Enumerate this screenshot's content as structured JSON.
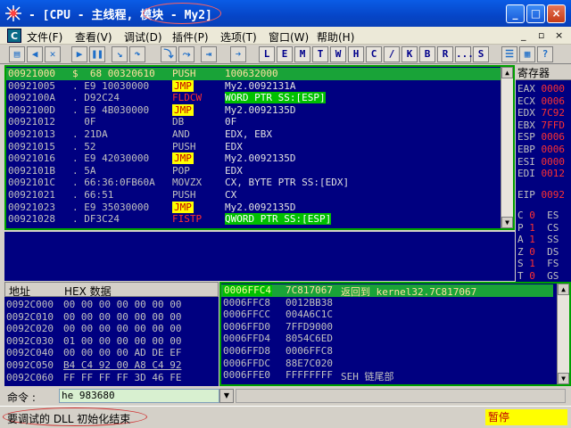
{
  "window": {
    "title": "- [CPU - 主线程, 模块 - My2]",
    "min": "_",
    "max": "□",
    "close": "×"
  },
  "menu": {
    "cpu_icon": "C",
    "items": [
      "文件(F)",
      "查看(V)",
      "调试(D)",
      "插件(P)",
      "选项(T)",
      "窗口(W)",
      "帮助(H)"
    ],
    "mdi": [
      "_",
      "▫",
      "×"
    ]
  },
  "toolbar": {
    "letters": [
      "L",
      "E",
      "M",
      "T",
      "W",
      "H",
      "C",
      "/",
      "K",
      "B",
      "R",
      "...",
      "S"
    ]
  },
  "disasm": {
    "rows": [
      {
        "addr": "00921000",
        "hex": "$  68 00320610",
        "mnem": "PUSH",
        "ops": "100632000",
        "sel": true
      },
      {
        "addr": "00921005",
        "hex": ". E9 10030000",
        "mnem": "JMP",
        "ops": "My2.0092131A",
        "tag": "jmp"
      },
      {
        "addr": "0092100A",
        "hex": ". D92C24",
        "mnem": "FLDCW",
        "ops": "WORD PTR SS:[ESP]",
        "tag": "red",
        "hl": true
      },
      {
        "addr": "0092100D",
        "hex": ". E9 4B030000",
        "mnem": "JMP",
        "ops": "My2.0092135D",
        "tag": "jmp"
      },
      {
        "addr": "00921012",
        "hex": "  0F",
        "mnem": "DB",
        "ops": "0F"
      },
      {
        "addr": "00921013",
        "hex": ". 21DA",
        "mnem": "AND",
        "ops": "EDX, EBX"
      },
      {
        "addr": "00921015",
        "hex": ". 52",
        "mnem": "PUSH",
        "ops": "EDX"
      },
      {
        "addr": "00921016",
        "hex": ". E9 42030000",
        "mnem": "JMP",
        "ops": "My2.0092135D",
        "tag": "jmp"
      },
      {
        "addr": "0092101B",
        "hex": ". 5A",
        "mnem": "POP",
        "ops": "EDX"
      },
      {
        "addr": "0092101C",
        "hex": ". 66:36:0FB60A",
        "mnem": "MOVZX",
        "ops": "CX, BYTE PTR SS:[EDX]"
      },
      {
        "addr": "00921021",
        "hex": ". 66:51",
        "mnem": "PUSH",
        "ops": "CX"
      },
      {
        "addr": "00921023",
        "hex": ". E9 35030000",
        "mnem": "JMP",
        "ops": "My2.0092135D",
        "tag": "jmp"
      },
      {
        "addr": "00921028",
        "hex": ". DF3C24",
        "mnem": "FISTP",
        "ops": "QWORD PTR SS:[ESP]",
        "tag": "red",
        "hl": true
      }
    ]
  },
  "registers": {
    "header": "寄存器",
    "items": [
      {
        "name": "EAX",
        "val": "0000"
      },
      {
        "name": "ECX",
        "val": "0006"
      },
      {
        "name": "EDX",
        "val": "7C92"
      },
      {
        "name": "EBX",
        "val": "7FFD"
      },
      {
        "name": "ESP",
        "val": "0006"
      },
      {
        "name": "EBP",
        "val": "0006"
      },
      {
        "name": "ESI",
        "val": "0000"
      },
      {
        "name": "EDI",
        "val": "0012"
      }
    ],
    "eip": {
      "name": "EIP",
      "val": "0092"
    },
    "flags": [
      {
        "f": "C",
        "v": "0",
        "seg": "ES"
      },
      {
        "f": "P",
        "v": "1",
        "seg": "CS"
      },
      {
        "f": "A",
        "v": "1",
        "seg": "SS"
      },
      {
        "f": "Z",
        "v": "0",
        "seg": "DS"
      },
      {
        "f": "S",
        "v": "1",
        "seg": "FS"
      },
      {
        "f": "T",
        "v": "0",
        "seg": "GS"
      }
    ]
  },
  "dump": {
    "col_addr": "地址",
    "col_hex": "HEX 数据",
    "rows": [
      {
        "addr": "0092C000",
        "hex": "00 00 00 00 00 00 00"
      },
      {
        "addr": "0092C010",
        "hex": "00 00 00 00 00 00 00"
      },
      {
        "addr": "0092C020",
        "hex": "00 00 00 00 00 00 00"
      },
      {
        "addr": "0092C030",
        "hex": "01 00 00 00 00 00 00"
      },
      {
        "addr": "0092C040",
        "hex": "00 00 00 00 AD DE EF"
      },
      {
        "addr": "0092C050",
        "hex": "B4 C4 92 00 A8 C4 92",
        "ul": true
      },
      {
        "addr": "0092C060",
        "hex": "FF FF FF FF 3D 46 FE"
      }
    ]
  },
  "stack": {
    "rows": [
      {
        "addr": "0006FFC4",
        "val": "7C817067",
        "cmt": "返回到 kernel32.7C817067",
        "sel": true
      },
      {
        "addr": "0006FFC8",
        "val": "0012BB38",
        "cmt": ""
      },
      {
        "addr": "0006FFCC",
        "val": "004A6C1C",
        "cmt": ""
      },
      {
        "addr": "0006FFD0",
        "val": "7FFD9000",
        "cmt": ""
      },
      {
        "addr": "0006FFD4",
        "val": "8054C6ED",
        "cmt": ""
      },
      {
        "addr": "0006FFD8",
        "val": "0006FFC8",
        "cmt": ""
      },
      {
        "addr": "0006FFDC",
        "val": "88E7C020",
        "cmt": ""
      },
      {
        "addr": "0006FFE0",
        "val": "FFFFFFFF",
        "cmt": "SEH 链尾部"
      }
    ]
  },
  "command": {
    "label": "命令 :",
    "value": "he 983680",
    "dropdown": "▼"
  },
  "status": {
    "message": "要调试的 DLL 初始化结束",
    "state": "暂停"
  }
}
